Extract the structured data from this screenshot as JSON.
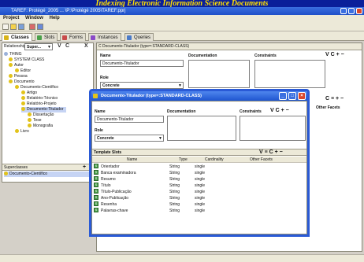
{
  "banner": "Indexing Electronic Information Science Documents",
  "window": {
    "title": "TAREF: Protégé_2005 ... \\P:\\Protégé 2005\\TAREF.pprj"
  },
  "menu": [
    "Project",
    "Window",
    "Help"
  ],
  "tabs": [
    "Classes",
    "Slots",
    "Forms",
    "Instances",
    "Queries"
  ],
  "left_panel": {
    "relationship_label": "Relationship",
    "relationship_value": "Super...",
    "buttons": [
      "V",
      "C",
      "X"
    ],
    "tree": [
      {
        "label": "THING",
        "depth": 0
      },
      {
        "label": "SYSTEM CLASS",
        "depth": 1
      },
      {
        "label": "Autor",
        "depth": 1
      },
      {
        "label": "Editor",
        "depth": 2
      },
      {
        "label": "Pessoa",
        "depth": 1
      },
      {
        "label": "Documento",
        "depth": 1
      },
      {
        "label": "Documento-Científico",
        "depth": 2
      },
      {
        "label": "Artigo",
        "depth": 3
      },
      {
        "label": "Relatório-Técnico",
        "depth": 3
      },
      {
        "label": "Relatório-Projeto",
        "depth": 3
      },
      {
        "label": "Documento-Titulador",
        "depth": 3
      },
      {
        "label": "Dissertação",
        "depth": 4
      },
      {
        "label": "Tese",
        "depth": 4
      },
      {
        "label": "Monografia",
        "depth": 4
      },
      {
        "label": "Livro",
        "depth": 2
      }
    ],
    "superclasses_label": "Superclasses",
    "superclass_item": "Documento-Científico"
  },
  "main_panel": {
    "header": "C Documento-Titulador (type=:STANDARD-CLASS)",
    "name_label": "Name",
    "name_value": "Documento-Titulador",
    "role_label": "Role",
    "role_value": "Concrete",
    "documentation_label": "Documentation",
    "constraints_label": "Constraints",
    "other_facets_label": "Other Facets"
  },
  "dialog": {
    "title": "Documento-Titulador (type=:STANDARD-CLASS)",
    "name_label": "Name",
    "name_value": "Documento-Titulador",
    "documentation_label": "Documentation",
    "constraints_label": "Constraints",
    "role_label": "Role",
    "role_value": "Concrete",
    "template_slots_label": "Template Slots",
    "columns": [
      "Name",
      "Type",
      "Cardinality",
      "Other Facets"
    ],
    "slots": [
      {
        "name": "Orientador",
        "type": "String",
        "cardinality": "single"
      },
      {
        "name": "Banca examinadora",
        "type": "String",
        "cardinality": "single"
      },
      {
        "name": "Resumo",
        "type": "String",
        "cardinality": "single"
      },
      {
        "name": "Título",
        "type": "String",
        "cardinality": "single"
      },
      {
        "name": "Título-Publicação",
        "type": "String",
        "cardinality": "single"
      },
      {
        "name": "Ano-Publicação",
        "type": "String",
        "cardinality": "single"
      },
      {
        "name": "Resenha",
        "type": "String",
        "cardinality": "single"
      },
      {
        "name": "Palavras-chave",
        "type": "String",
        "cardinality": "single"
      }
    ]
  },
  "colors": {
    "banner_bg": "#0a1f9a",
    "banner_text": "#ffe000",
    "titlebar": "#1e4fc8",
    "selection": "#c6d4f4"
  }
}
